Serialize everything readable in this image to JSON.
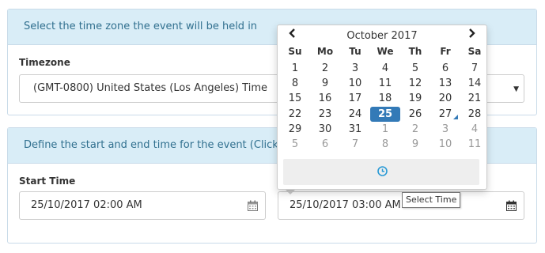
{
  "timezone_panel": {
    "heading": "Select the time zone the event will be held in",
    "label": "Timezone",
    "selected": "(GMT-0800) United States (Los Angeles) Time"
  },
  "time_panel": {
    "heading": "Define the start and end time for the event (Click the",
    "start_label": "Start Time",
    "start_value": "25/10/2017 02:00 AM",
    "end_value": "25/10/2017 03:00 AM"
  },
  "datepicker": {
    "month_title": "October 2017",
    "weekdays": [
      "Su",
      "Mo",
      "Tu",
      "We",
      "Th",
      "Fr",
      "Sa"
    ],
    "weeks": [
      [
        {
          "d": "1",
          "m": false
        },
        {
          "d": "2",
          "m": false
        },
        {
          "d": "3",
          "m": false
        },
        {
          "d": "4",
          "m": false
        },
        {
          "d": "5",
          "m": false
        },
        {
          "d": "6",
          "m": false
        },
        {
          "d": "7",
          "m": false
        }
      ],
      [
        {
          "d": "8",
          "m": false
        },
        {
          "d": "9",
          "m": false
        },
        {
          "d": "10",
          "m": false
        },
        {
          "d": "11",
          "m": false
        },
        {
          "d": "12",
          "m": false
        },
        {
          "d": "13",
          "m": false
        },
        {
          "d": "14",
          "m": false
        }
      ],
      [
        {
          "d": "15",
          "m": false
        },
        {
          "d": "16",
          "m": false
        },
        {
          "d": "17",
          "m": false
        },
        {
          "d": "18",
          "m": false
        },
        {
          "d": "19",
          "m": false
        },
        {
          "d": "20",
          "m": false
        },
        {
          "d": "21",
          "m": false
        }
      ],
      [
        {
          "d": "22",
          "m": false
        },
        {
          "d": "23",
          "m": false
        },
        {
          "d": "24",
          "m": false
        },
        {
          "d": "25",
          "m": false
        },
        {
          "d": "26",
          "m": false
        },
        {
          "d": "27",
          "m": false
        },
        {
          "d": "28",
          "m": false
        }
      ],
      [
        {
          "d": "29",
          "m": false
        },
        {
          "d": "30",
          "m": false
        },
        {
          "d": "31",
          "m": false
        },
        {
          "d": "1",
          "m": true
        },
        {
          "d": "2",
          "m": true
        },
        {
          "d": "3",
          "m": true
        },
        {
          "d": "4",
          "m": true
        }
      ],
      [
        {
          "d": "5",
          "m": true
        },
        {
          "d": "6",
          "m": true
        },
        {
          "d": "7",
          "m": true
        },
        {
          "d": "8",
          "m": true
        },
        {
          "d": "9",
          "m": true
        },
        {
          "d": "10",
          "m": true
        },
        {
          "d": "11",
          "m": true
        }
      ]
    ],
    "selected_day": "25",
    "today_day": "27",
    "accent_color": "#337ab7"
  },
  "tooltip": "Select Time",
  "icons": {
    "prev": "chevron-left-icon",
    "next": "chevron-right-icon",
    "calendar": "calendar-icon",
    "clock": "clock-icon",
    "dropdown": "caret-down-icon"
  }
}
